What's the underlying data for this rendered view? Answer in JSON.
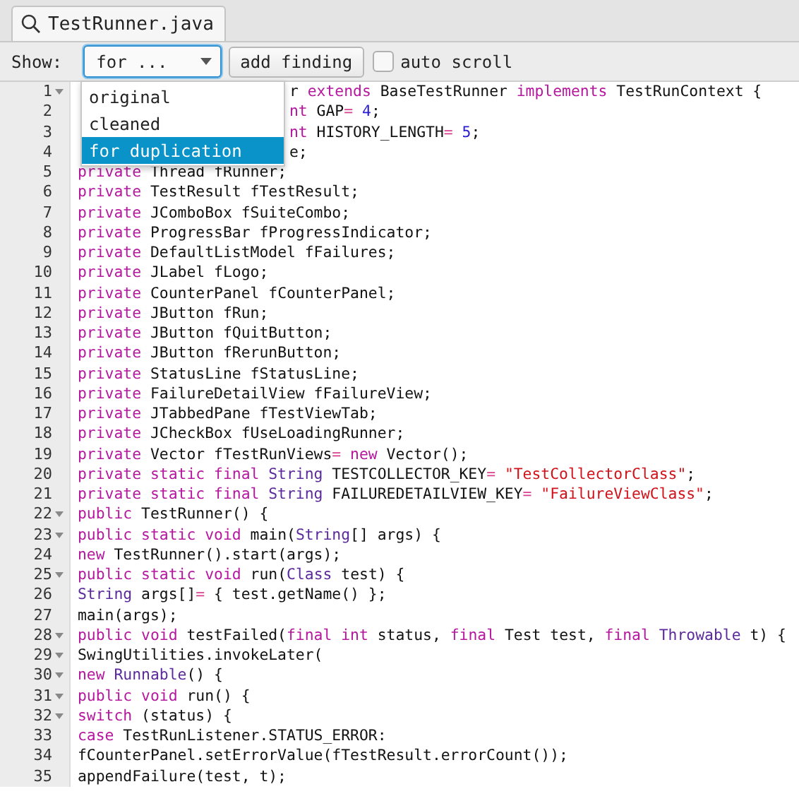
{
  "tab": {
    "title": "TestRunner.java",
    "selected": true
  },
  "toolbar": {
    "show_label": "Show:",
    "combo": {
      "value": "for ...",
      "open": true,
      "options": [
        {
          "label": "original",
          "selected": false
        },
        {
          "label": "cleaned",
          "selected": false
        },
        {
          "label": "for duplication",
          "selected": true
        }
      ]
    },
    "add_button": "add finding",
    "auto_scroll": {
      "label": "auto scroll",
      "checked": false
    }
  },
  "code": [
    {
      "number": "1",
      "fold": true,
      "tokens": [
        {
          "text": "r ",
          "kind": "plain"
        },
        {
          "text": "extends",
          "kind": "kw"
        },
        {
          "text": " BaseTestRunner ",
          "kind": "plain"
        },
        {
          "text": "implements",
          "kind": "kw"
        },
        {
          "text": " TestRunContext {",
          "kind": "plain"
        }
      ]
    },
    {
      "number": "2",
      "fold": false,
      "tokens": [
        {
          "text": "nt",
          "kind": "kw"
        },
        {
          "text": " GAP",
          "kind": "plain"
        },
        {
          "text": "= ",
          "kind": "op"
        },
        {
          "text": "4",
          "kind": "num"
        },
        {
          "text": ";",
          "kind": "plain"
        }
      ]
    },
    {
      "number": "3",
      "fold": false,
      "tokens": [
        {
          "text": "nt",
          "kind": "kw"
        },
        {
          "text": " HISTORY_LENGTH",
          "kind": "plain"
        },
        {
          "text": "= ",
          "kind": "op"
        },
        {
          "text": "5",
          "kind": "num"
        },
        {
          "text": ";",
          "kind": "plain"
        }
      ]
    },
    {
      "number": "4",
      "fold": false,
      "tokens": [
        {
          "text": "e;",
          "kind": "plain"
        }
      ]
    },
    {
      "number": "5",
      "fold": false,
      "tokens": [
        {
          "text": "private",
          "kind": "kw"
        },
        {
          "text": " Thread fRunner;",
          "kind": "plain"
        }
      ]
    },
    {
      "number": "6",
      "fold": false,
      "tokens": [
        {
          "text": "private",
          "kind": "kw"
        },
        {
          "text": " TestResult fTestResult;",
          "kind": "plain"
        }
      ]
    },
    {
      "number": "7",
      "fold": false,
      "tokens": [
        {
          "text": "private",
          "kind": "kw"
        },
        {
          "text": " JComboBox fSuiteCombo;",
          "kind": "plain"
        }
      ]
    },
    {
      "number": "8",
      "fold": false,
      "tokens": [
        {
          "text": "private",
          "kind": "kw"
        },
        {
          "text": " ProgressBar fProgressIndicator;",
          "kind": "plain"
        }
      ]
    },
    {
      "number": "9",
      "fold": false,
      "tokens": [
        {
          "text": "private",
          "kind": "kw"
        },
        {
          "text": " DefaultListModel fFailures;",
          "kind": "plain"
        }
      ]
    },
    {
      "number": "10",
      "fold": false,
      "tokens": [
        {
          "text": "private",
          "kind": "kw"
        },
        {
          "text": " JLabel fLogo;",
          "kind": "plain"
        }
      ]
    },
    {
      "number": "11",
      "fold": false,
      "tokens": [
        {
          "text": "private",
          "kind": "kw"
        },
        {
          "text": " CounterPanel fCounterPanel;",
          "kind": "plain"
        }
      ]
    },
    {
      "number": "12",
      "fold": false,
      "tokens": [
        {
          "text": "private",
          "kind": "kw"
        },
        {
          "text": " JButton fRun;",
          "kind": "plain"
        }
      ]
    },
    {
      "number": "13",
      "fold": false,
      "tokens": [
        {
          "text": "private",
          "kind": "kw"
        },
        {
          "text": " JButton fQuitButton;",
          "kind": "plain"
        }
      ]
    },
    {
      "number": "14",
      "fold": false,
      "tokens": [
        {
          "text": "private",
          "kind": "kw"
        },
        {
          "text": " JButton fRerunButton;",
          "kind": "plain"
        }
      ]
    },
    {
      "number": "15",
      "fold": false,
      "tokens": [
        {
          "text": "private",
          "kind": "kw"
        },
        {
          "text": " StatusLine fStatusLine;",
          "kind": "plain"
        }
      ]
    },
    {
      "number": "16",
      "fold": false,
      "tokens": [
        {
          "text": "private",
          "kind": "kw"
        },
        {
          "text": " FailureDetailView fFailureView;",
          "kind": "plain"
        }
      ]
    },
    {
      "number": "17",
      "fold": false,
      "tokens": [
        {
          "text": "private",
          "kind": "kw"
        },
        {
          "text": " JTabbedPane fTestViewTab;",
          "kind": "plain"
        }
      ]
    },
    {
      "number": "18",
      "fold": false,
      "tokens": [
        {
          "text": "private",
          "kind": "kw"
        },
        {
          "text": " JCheckBox fUseLoadingRunner;",
          "kind": "plain"
        }
      ]
    },
    {
      "number": "19",
      "fold": false,
      "tokens": [
        {
          "text": "private",
          "kind": "kw"
        },
        {
          "text": " Vector fTestRunViews",
          "kind": "plain"
        },
        {
          "text": "= ",
          "kind": "op"
        },
        {
          "text": "new",
          "kind": "kw"
        },
        {
          "text": " Vector();",
          "kind": "plain"
        }
      ]
    },
    {
      "number": "20",
      "fold": false,
      "tokens": [
        {
          "text": "private static final ",
          "kind": "kw"
        },
        {
          "text": "String",
          "kind": "type"
        },
        {
          "text": " TESTCOLLECTOR_KEY",
          "kind": "plain"
        },
        {
          "text": "= ",
          "kind": "op"
        },
        {
          "text": "\"TestCollectorClass\"",
          "kind": "str"
        },
        {
          "text": ";",
          "kind": "plain"
        }
      ]
    },
    {
      "number": "21",
      "fold": false,
      "tokens": [
        {
          "text": "private static final ",
          "kind": "kw"
        },
        {
          "text": "String",
          "kind": "type"
        },
        {
          "text": " FAILUREDETAILVIEW_KEY",
          "kind": "plain"
        },
        {
          "text": "= ",
          "kind": "op"
        },
        {
          "text": "\"FailureViewClass\"",
          "kind": "str"
        },
        {
          "text": ";",
          "kind": "plain"
        }
      ]
    },
    {
      "number": "22",
      "fold": true,
      "tokens": [
        {
          "text": "public",
          "kind": "kw"
        },
        {
          "text": " TestRunner() {",
          "kind": "plain"
        }
      ]
    },
    {
      "number": "23",
      "fold": true,
      "tokens": [
        {
          "text": "public static void",
          "kind": "kw"
        },
        {
          "text": " main(",
          "kind": "plain"
        },
        {
          "text": "String",
          "kind": "type"
        },
        {
          "text": "[] args) {",
          "kind": "plain"
        }
      ]
    },
    {
      "number": "24",
      "fold": false,
      "tokens": [
        {
          "text": "new",
          "kind": "kw"
        },
        {
          "text": " TestRunner().start(args);",
          "kind": "plain"
        }
      ]
    },
    {
      "number": "25",
      "fold": true,
      "tokens": [
        {
          "text": "public static void",
          "kind": "kw"
        },
        {
          "text": " run(",
          "kind": "plain"
        },
        {
          "text": "Class",
          "kind": "type"
        },
        {
          "text": " test) {",
          "kind": "plain"
        }
      ]
    },
    {
      "number": "26",
      "fold": false,
      "tokens": [
        {
          "text": "String",
          "kind": "type"
        },
        {
          "text": " args[]",
          "kind": "plain"
        },
        {
          "text": "=",
          "kind": "op"
        },
        {
          "text": " { test.getName() };",
          "kind": "plain"
        }
      ]
    },
    {
      "number": "27",
      "fold": false,
      "tokens": [
        {
          "text": "main(args);",
          "kind": "plain"
        }
      ]
    },
    {
      "number": "28",
      "fold": true,
      "tokens": [
        {
          "text": "public void",
          "kind": "kw"
        },
        {
          "text": " testFailed(",
          "kind": "plain"
        },
        {
          "text": "final int",
          "kind": "kw"
        },
        {
          "text": " status, ",
          "kind": "plain"
        },
        {
          "text": "final",
          "kind": "kw"
        },
        {
          "text": " Test test, ",
          "kind": "plain"
        },
        {
          "text": "final ",
          "kind": "kw"
        },
        {
          "text": "Throwable",
          "kind": "type"
        },
        {
          "text": " t) {",
          "kind": "plain"
        }
      ]
    },
    {
      "number": "29",
      "fold": true,
      "tokens": [
        {
          "text": "SwingUtilities.invokeLater(",
          "kind": "plain"
        }
      ]
    },
    {
      "number": "30",
      "fold": true,
      "tokens": [
        {
          "text": "new ",
          "kind": "kw"
        },
        {
          "text": "Runnable",
          "kind": "type"
        },
        {
          "text": "() {",
          "kind": "plain"
        }
      ]
    },
    {
      "number": "31",
      "fold": true,
      "tokens": [
        {
          "text": "public void",
          "kind": "kw"
        },
        {
          "text": " run() {",
          "kind": "plain"
        }
      ]
    },
    {
      "number": "32",
      "fold": true,
      "tokens": [
        {
          "text": "switch",
          "kind": "kw"
        },
        {
          "text": " (status) {",
          "kind": "plain"
        }
      ]
    },
    {
      "number": "33",
      "fold": false,
      "tokens": [
        {
          "text": "case",
          "kind": "kw"
        },
        {
          "text": " TestRunListener.STATUS_ERROR:",
          "kind": "plain"
        }
      ]
    },
    {
      "number": "34",
      "fold": false,
      "tokens": [
        {
          "text": "fCounterPanel.setErrorValue(fTestResult.errorCount());",
          "kind": "plain"
        }
      ]
    },
    {
      "number": "35",
      "fold": false,
      "tokens": [
        {
          "text": "appendFailure(test, t);",
          "kind": "plain"
        }
      ]
    }
  ]
}
